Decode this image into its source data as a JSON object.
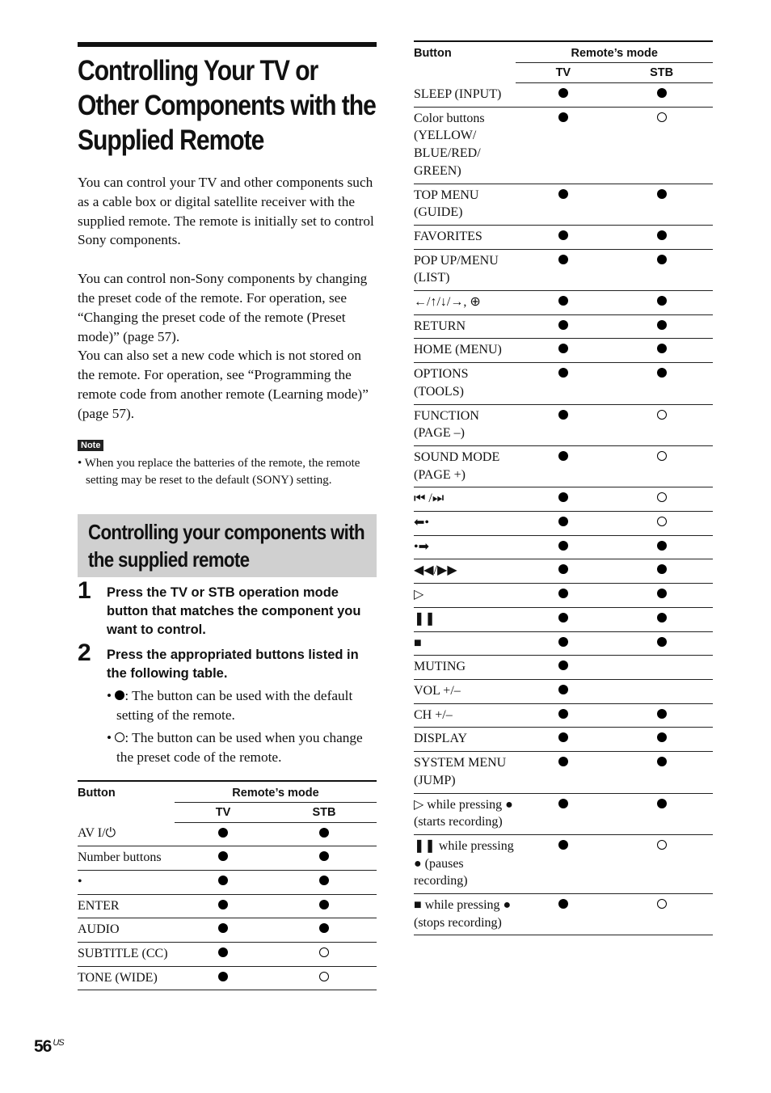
{
  "title": "Controlling Your TV or Other Components with the Supplied Remote",
  "intro": [
    "You can control your TV and other components such as a cable box or digital satellite receiver with the supplied remote. The remote is initially set to control Sony components.",
    "You can control non-Sony components by changing the preset code of the remote. For operation, see “Changing the preset code of the remote (Preset mode)” (page 57).",
    "You can also set a new code which is not stored on the remote. For operation, see “Programming the remote code from another remote (Learning mode)” (page 57)."
  ],
  "note": {
    "tag": "Note",
    "text": "• When you replace the batteries of the remote, the remote setting may be reset to the default (SONY) setting."
  },
  "section_heading": "Controlling your components with the supplied remote",
  "steps": [
    {
      "num": "1",
      "text": "Press the TV or STB operation mode button that matches the component you want to control."
    },
    {
      "num": "2",
      "text": "Press the appropriated buttons listed in the following table."
    }
  ],
  "legend": [
    {
      "symbol": "filled",
      "text": ": The button can be used with the default setting of the remote."
    },
    {
      "symbol": "open",
      "text": ": The button can be used when you change the preset code of the remote."
    }
  ],
  "table_header": {
    "button": "Button",
    "mode": "Remote’s mode",
    "tv": "TV",
    "stb": "STB"
  },
  "table_left": [
    {
      "button": "AV I/⏻",
      "tv": "filled",
      "stb": "filled"
    },
    {
      "button": "Number buttons",
      "tv": "filled",
      "stb": "filled"
    },
    {
      "button": " •",
      "tv": "filled",
      "stb": "filled"
    },
    {
      "button": "ENTER",
      "tv": "filled",
      "stb": "filled"
    },
    {
      "button": "AUDIO",
      "tv": "filled",
      "stb": "filled"
    },
    {
      "button": "SUBTITLE (CC)",
      "tv": "filled",
      "stb": "open"
    },
    {
      "button": "TONE (WIDE)",
      "tv": "filled",
      "stb": "open"
    }
  ],
  "table_right": [
    {
      "button": "SLEEP (INPUT)",
      "tv": "filled",
      "stb": "filled"
    },
    {
      "button": "Color buttons (YELLOW/ BLUE/RED/ GREEN)",
      "tv": "filled",
      "stb": "open"
    },
    {
      "button": "TOP MENU (GUIDE)",
      "tv": "filled",
      "stb": "filled"
    },
    {
      "button": "FAVORITES",
      "tv": "filled",
      "stb": "filled"
    },
    {
      "button": "POP UP/MENU (LIST)",
      "tv": "filled",
      "stb": "filled"
    },
    {
      "button": "←/↑/↓/→, ⊕",
      "tv": "filled",
      "stb": "filled"
    },
    {
      "button": "RETURN",
      "tv": "filled",
      "stb": "filled"
    },
    {
      "button": "HOME (MENU)",
      "tv": "filled",
      "stb": "filled"
    },
    {
      "button": "OPTIONS (TOOLS)",
      "tv": "filled",
      "stb": "filled"
    },
    {
      "button": "FUNCTION (PAGE –)",
      "tv": "filled",
      "stb": "open"
    },
    {
      "button": "SOUND MODE (PAGE +)",
      "tv": "filled",
      "stb": "open"
    },
    {
      "button": "⏮ /⏭",
      "tv": "filled",
      "stb": "open"
    },
    {
      "button": "⬅•",
      "tv": "filled",
      "stb": "open"
    },
    {
      "button": "•➡",
      "tv": "filled",
      "stb": "filled"
    },
    {
      "button": "◀◀/▶▶",
      "tv": "filled",
      "stb": "filled"
    },
    {
      "button": "▷",
      "tv": "filled",
      "stb": "filled"
    },
    {
      "button": "❚❚",
      "tv": "filled",
      "stb": "filled"
    },
    {
      "button": "■",
      "tv": "filled",
      "stb": "filled"
    },
    {
      "button": "MUTING",
      "tv": "filled",
      "stb": ""
    },
    {
      "button": "VOL +/–",
      "tv": "filled",
      "stb": ""
    },
    {
      "button": "CH +/–",
      "tv": "filled",
      "stb": "filled"
    },
    {
      "button": "DISPLAY",
      "tv": "filled",
      "stb": "filled"
    },
    {
      "button": "SYSTEM MENU (JUMP)",
      "tv": "filled",
      "stb": "filled"
    },
    {
      "button": "▷ while pressing ● (starts recording)",
      "tv": "filled",
      "stb": "filled"
    },
    {
      "button": "❚❚ while pressing ● (pauses recording)",
      "tv": "filled",
      "stb": "open"
    },
    {
      "button": "■ while pressing ● (stops recording)",
      "tv": "filled",
      "stb": "open"
    }
  ],
  "page_number": "56",
  "page_suffix": "US"
}
